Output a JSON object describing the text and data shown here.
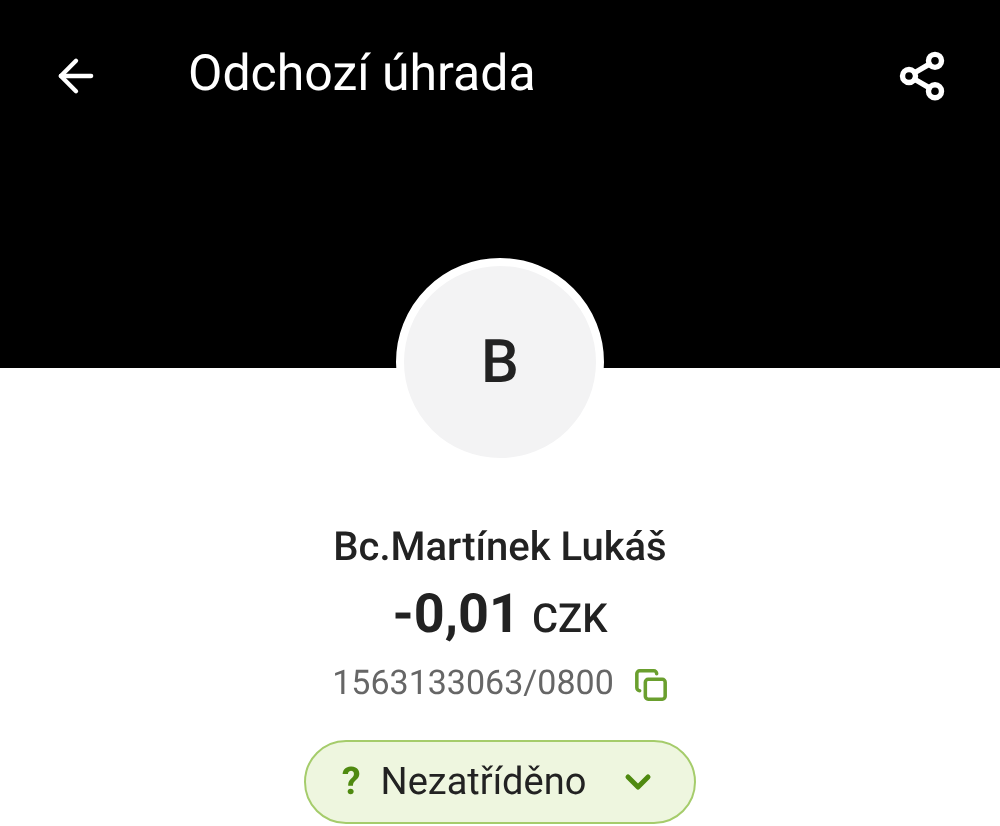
{
  "app_bar": {
    "title": "Odchozí úhrada"
  },
  "counterparty": {
    "avatar_letter": "B",
    "name": "Bc.Martínek Lukáš",
    "amount": "-0,01",
    "currency": "CZK",
    "account": "1563133063/0800"
  },
  "category": {
    "icon": "?",
    "label": "Nezatříděno"
  }
}
